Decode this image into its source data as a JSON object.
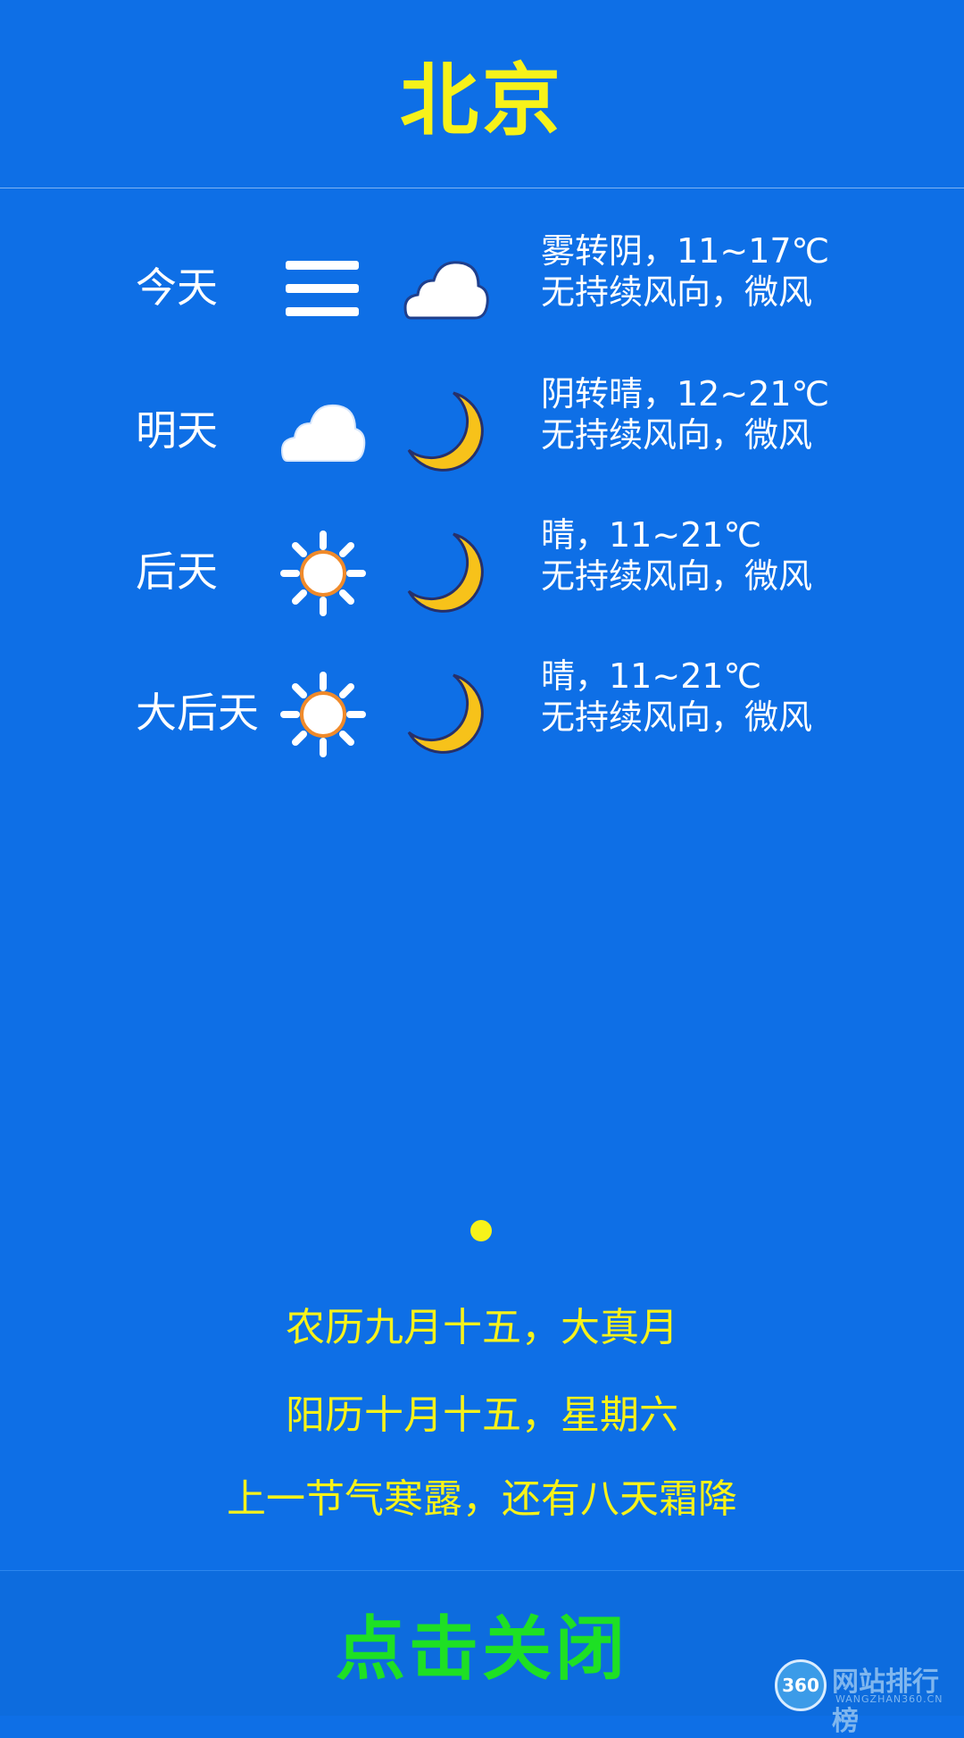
{
  "header": {
    "city": "北京"
  },
  "forecast": [
    {
      "label": "今天",
      "day_icon": "fog-icon",
      "night_icon": "cloud-icon",
      "line1": "雾转阴，11~17℃",
      "line2": "无持续风向，微风"
    },
    {
      "label": "明天",
      "day_icon": "cloud-icon",
      "night_icon": "moon-icon",
      "line1": "阴转晴，12~21℃",
      "line2": "无持续风向，微风"
    },
    {
      "label": "后天",
      "day_icon": "sun-icon",
      "night_icon": "moon-icon",
      "line1": "晴，11~21℃",
      "line2": "无持续风向，微风"
    },
    {
      "label": "大后天",
      "day_icon": "sun-icon",
      "night_icon": "moon-icon",
      "line1": "晴，11~21℃",
      "line2": "无持续风向，微风"
    }
  ],
  "calendar": {
    "lunar": "农历九月十五，大真月",
    "solar": "阳历十月十五，星期六",
    "solar_term": "上一节气寒露，还有八天霜降"
  },
  "footer": {
    "close_label": "点击关闭"
  },
  "watermark": {
    "badge": "360",
    "title": "网站排行榜",
    "sub": "WANGZHAN360.CN"
  },
  "colors": {
    "background": "#0e6fe6",
    "accent_yellow": "#f7f21a",
    "close_green": "#1ee024"
  }
}
